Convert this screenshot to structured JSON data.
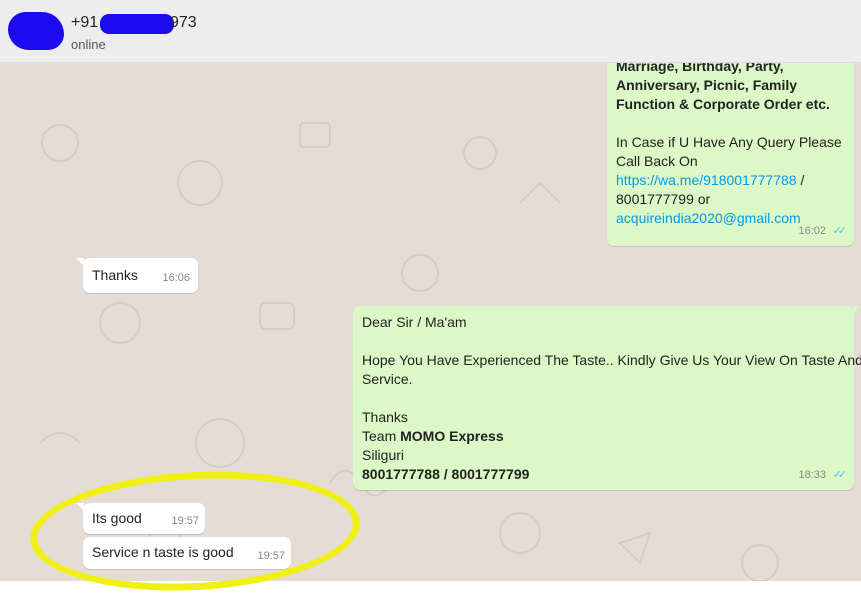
{
  "header": {
    "name_prefix": "+91",
    "name_suffix": "973",
    "status": "online"
  },
  "messages": {
    "m1": {
      "line1": "Marriage, Birthday, Party,",
      "line2": "Anniversary, Picnic, Family",
      "line3": "Function & Corporate Order etc.",
      "line4": "In Case if U Have Any Query Please",
      "line5": "Call Back On",
      "link": "https://wa.me/918001777788",
      "link_after": " /",
      "line7": "8001777799 or",
      "email": "acquireindia2020@gmail.com",
      "time": "16:02",
      "ticks": "✓✓"
    },
    "m2": {
      "text": "Thanks",
      "time": "16:06"
    },
    "m3": {
      "greeting": "Dear Sir / Ma'am",
      "body1": "Hope You Have Experienced The Taste.. Kindly Give Us Your View On Taste And",
      "body2": "Service.",
      "thanks": "Thanks",
      "team_prefix": "Team ",
      "team_name": "MOMO Express",
      "city": "Siliguri",
      "phones": "8001777788 / 8001777799",
      "time": "18:33",
      "ticks": "✓✓"
    },
    "m4": {
      "text": "Its good",
      "time": "19:57"
    },
    "m5": {
      "text": "Service n taste is good",
      "time": "19:57"
    }
  },
  "colors": {
    "incoming": "#ffffff",
    "outgoing": "#dcf8c6",
    "chat_background": "#e5ddd5",
    "read_ticks": "#4fc3f7",
    "link": "#039be5",
    "redaction": "#1a0bf0",
    "highlight_marker": "#f0f016"
  }
}
